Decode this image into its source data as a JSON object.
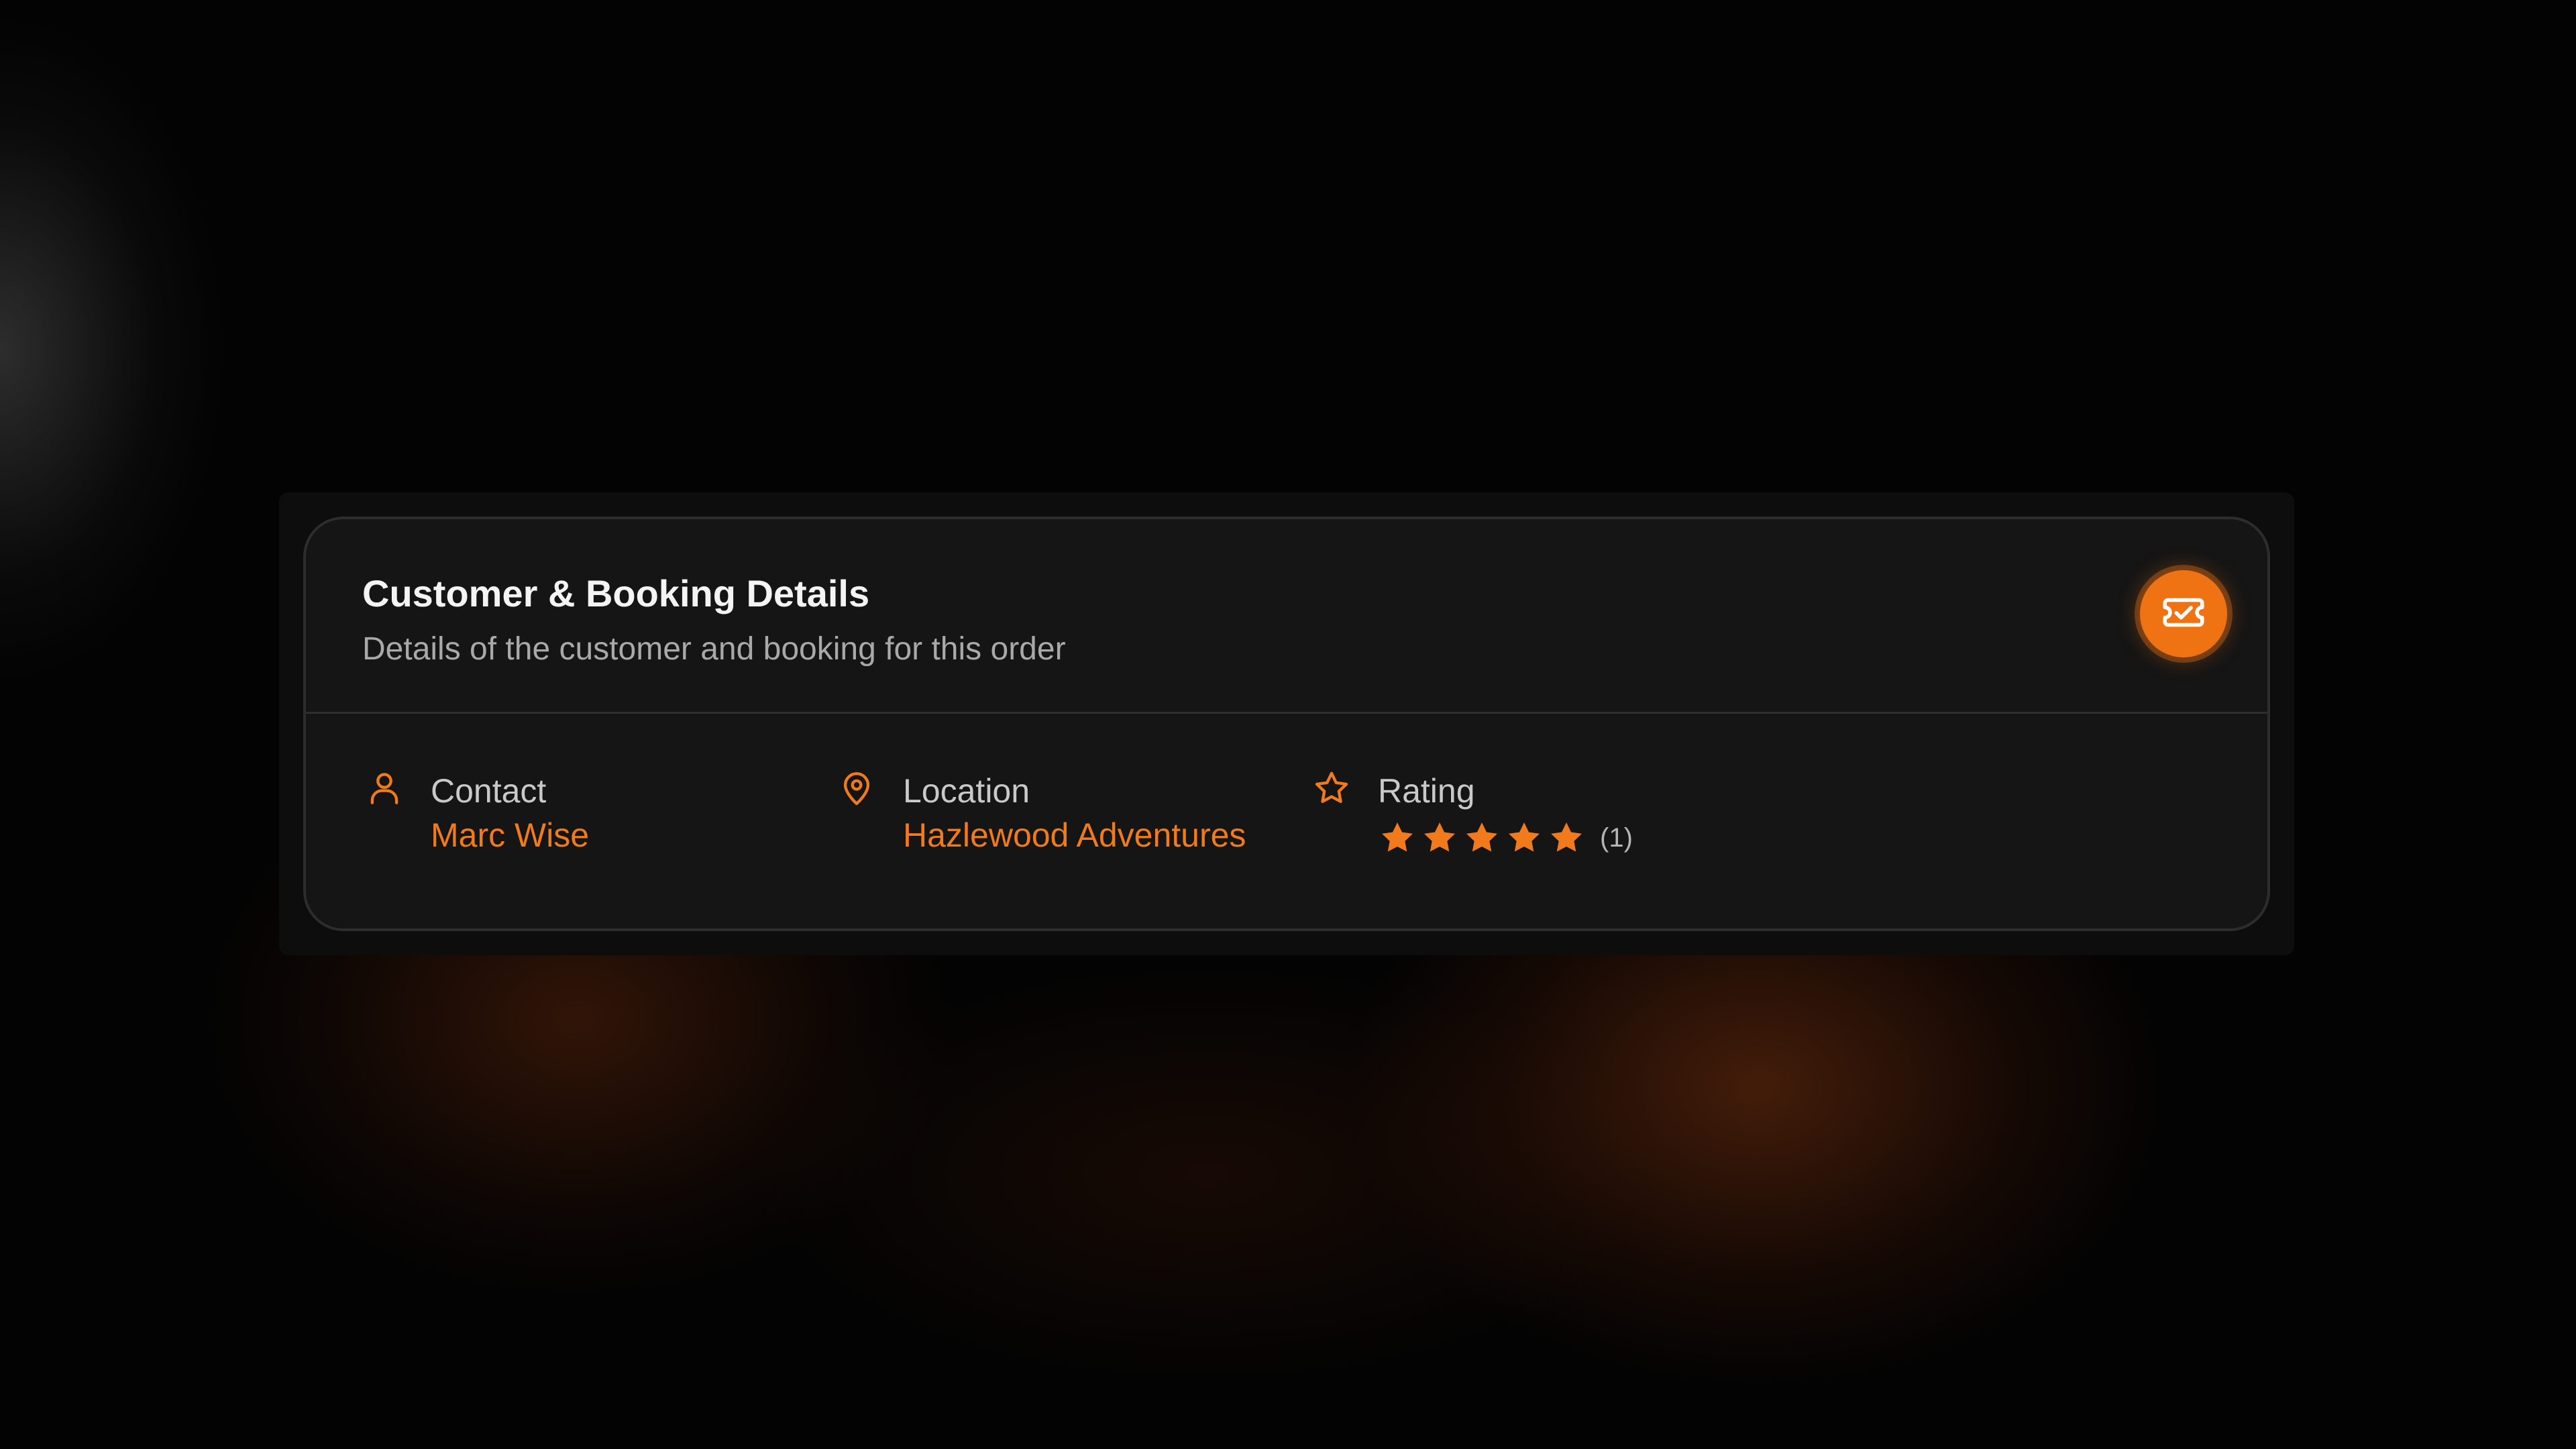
{
  "card": {
    "title": "Customer & Booking Details",
    "subtitle": "Details of the customer and booking for this order",
    "action_icon": "ticket-check-icon"
  },
  "fields": {
    "contact": {
      "icon": "user-icon",
      "label": "Contact",
      "value": "Marc Wise"
    },
    "location": {
      "icon": "map-pin-icon",
      "label": "Location",
      "value": "Hazlewood Adventures"
    },
    "rating": {
      "icon": "star-outline-icon",
      "label": "Rating",
      "stars_filled": 5,
      "stars_total": 5,
      "count": "(1)"
    }
  },
  "colors": {
    "accent": "#ef7313",
    "card_background": "#151515",
    "title_text": "#f4f4f4",
    "subtitle_text": "#a9a9a9"
  }
}
